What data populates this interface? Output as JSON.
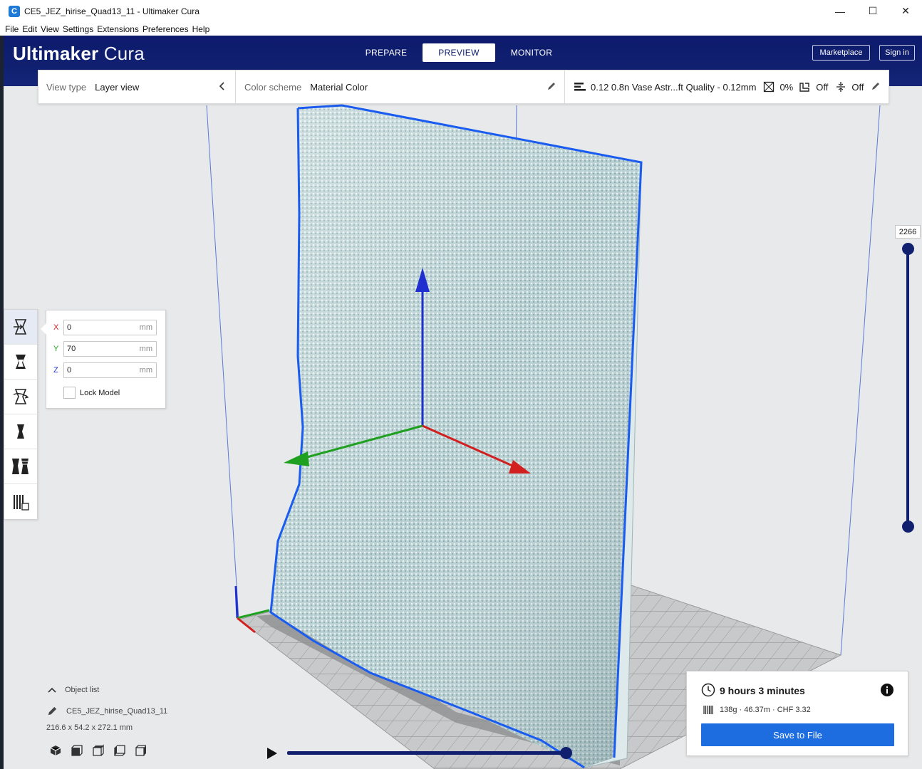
{
  "window": {
    "title": "CE5_JEZ_hirise_Quad13_11 - Ultimaker Cura",
    "minimize": "—",
    "maximize": "☐",
    "close": "✕"
  },
  "menu": [
    "File",
    "Edit",
    "View",
    "Settings",
    "Extensions",
    "Preferences",
    "Help"
  ],
  "header": {
    "brand_bold": "Ultimaker",
    "brand_light": "Cura",
    "tabs": [
      {
        "label": "PREPARE",
        "active": false
      },
      {
        "label": "PREVIEW",
        "active": true
      },
      {
        "label": "MONITOR",
        "active": false
      }
    ],
    "marketplace": "Marketplace",
    "sign_in": "Sign in"
  },
  "settings_bar": {
    "view_type_label": "View type",
    "view_type_value": "Layer view",
    "color_scheme_label": "Color scheme",
    "color_scheme_value": "Material Color",
    "profile": "0.12 0.8n Vase Astr...ft Quality - 0.12mm",
    "infill": "0%",
    "support": "Off",
    "adhesion": "Off"
  },
  "move_tool": {
    "x_label": "X",
    "x_value": "0",
    "y_label": "Y",
    "y_value": "70",
    "z_label": "Z",
    "z_value": "0",
    "unit": "mm",
    "lock_label": "Lock Model"
  },
  "tools": [
    "move-tool",
    "scale-tool",
    "rotate-tool",
    "mirror-tool",
    "per-model-settings-tool",
    "support-blocker-tool"
  ],
  "layer_slider": {
    "max_layer": "2266"
  },
  "object_list": {
    "header": "Object list",
    "object_name": "CE5_JEZ_hirise_Quad13_11",
    "dimensions": "216.6 x 54.2 x 272.1 mm"
  },
  "print_info": {
    "time": "9 hours 3 minutes",
    "material": "138g · 46.37m · CHF 3.32",
    "save_button": "Save to File"
  },
  "colors": {
    "header_blue": "#10206f",
    "accent_blue": "#1e6de0",
    "model_color": "#bcd4d6",
    "axis_x": "#d22020",
    "axis_y": "#20a020",
    "axis_z": "#2030d0"
  }
}
